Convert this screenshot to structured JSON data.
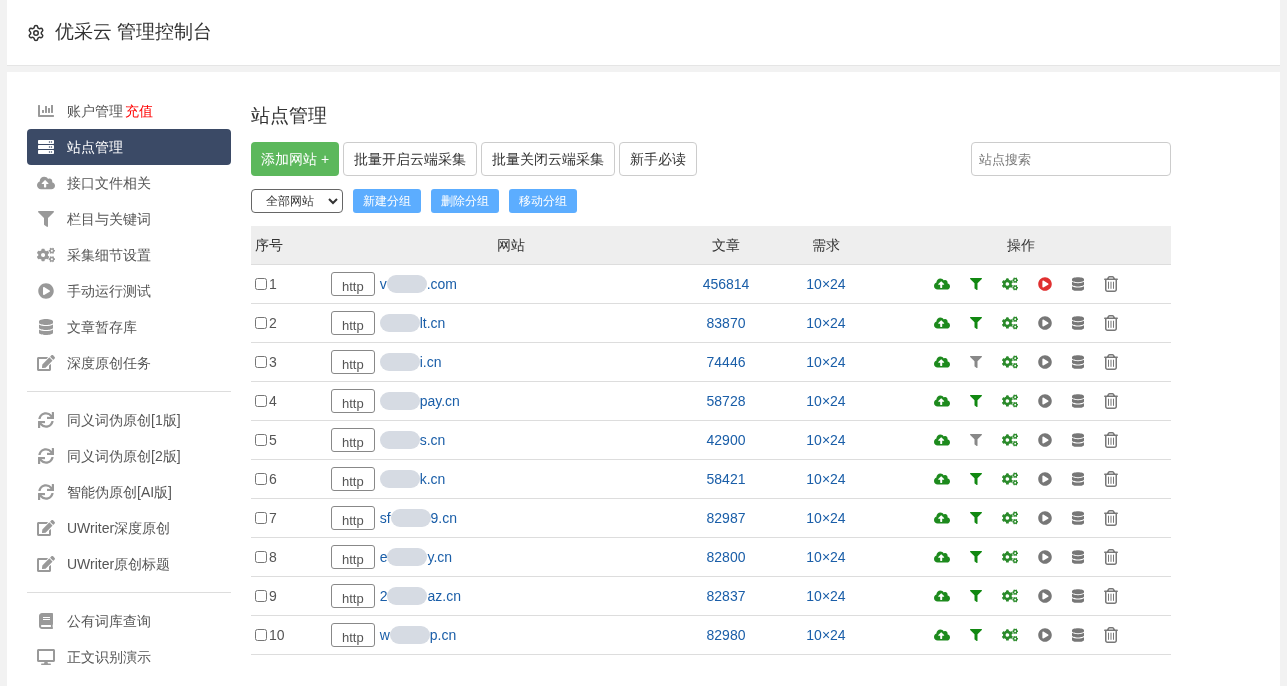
{
  "header": {
    "title": "优采云 管理控制台"
  },
  "sidebar": {
    "groups": [
      [
        {
          "kind": "chart",
          "label": "账户管理",
          "extra": "充值",
          "selected": false
        },
        {
          "kind": "list",
          "label": "站点管理",
          "selected": true
        },
        {
          "kind": "cloud",
          "label": "接口文件相关",
          "selected": false
        },
        {
          "kind": "filter",
          "label": "栏目与关键词",
          "selected": false
        },
        {
          "kind": "cogs",
          "label": "采集细节设置",
          "selected": false
        },
        {
          "kind": "play",
          "label": "手动运行测试",
          "selected": false
        },
        {
          "kind": "database",
          "label": "文章暂存库",
          "selected": false
        },
        {
          "kind": "edit",
          "label": "深度原创任务",
          "selected": false
        }
      ],
      [
        {
          "kind": "sync",
          "label": "同义词伪原创[1版]",
          "selected": false
        },
        {
          "kind": "sync",
          "label": "同义词伪原创[2版]",
          "selected": false
        },
        {
          "kind": "sync",
          "label": "智能伪原创[AI版]",
          "selected": false
        },
        {
          "kind": "edit",
          "label": "UWriter深度原创",
          "selected": false
        },
        {
          "kind": "edit",
          "label": "UWriter原创标题",
          "selected": false
        }
      ],
      [
        {
          "kind": "book",
          "label": "公有词库查询",
          "selected": false
        },
        {
          "kind": "desktop",
          "label": "正文识别演示",
          "selected": false
        }
      ]
    ]
  },
  "main": {
    "title": "站点管理",
    "buttons": [
      {
        "kind": "primary",
        "label": "添加网站 +"
      },
      {
        "kind": "default",
        "label": "批量开启云端采集"
      },
      {
        "kind": "default",
        "label": "批量关闭云端采集"
      },
      {
        "kind": "default",
        "label": "新手必读"
      }
    ],
    "search": {
      "placeholder": "站点搜索"
    },
    "group_select": "全部网站",
    "group_buttons": [
      "新建分组",
      "删除分组",
      "移动分组"
    ],
    "table": {
      "columns": [
        "序号",
        "网站",
        "文章",
        "需求",
        "操作"
      ],
      "rows": [
        {
          "checked": false,
          "no": "1",
          "scheme": "http",
          "prefix": "v",
          "suffix": ".com",
          "articles": "456814",
          "demand": "10×24",
          "filter_on": true,
          "running": true
        },
        {
          "checked": false,
          "no": "2",
          "scheme": "http",
          "prefix": "",
          "suffix": "lt.cn",
          "articles": "83870",
          "demand": "10×24",
          "filter_on": true,
          "running": false
        },
        {
          "checked": false,
          "no": "3",
          "scheme": "http",
          "prefix": "",
          "suffix": "i.cn",
          "articles": "74446",
          "demand": "10×24",
          "filter_on": false,
          "running": false
        },
        {
          "checked": false,
          "no": "4",
          "scheme": "http",
          "prefix": "",
          "suffix": "pay.cn",
          "articles": "58728",
          "demand": "10×24",
          "filter_on": true,
          "running": false
        },
        {
          "checked": false,
          "no": "5",
          "scheme": "http",
          "prefix": "",
          "suffix": "s.cn",
          "articles": "42900",
          "demand": "10×24",
          "filter_on": false,
          "running": false
        },
        {
          "checked": false,
          "no": "6",
          "scheme": "http",
          "prefix": "",
          "suffix": "k.cn",
          "articles": "58421",
          "demand": "10×24",
          "filter_on": true,
          "running": false
        },
        {
          "checked": false,
          "no": "7",
          "scheme": "http",
          "prefix": "sf",
          "suffix": "9.cn",
          "articles": "82987",
          "demand": "10×24",
          "filter_on": true,
          "running": false
        },
        {
          "checked": false,
          "no": "8",
          "scheme": "http",
          "prefix": "e",
          "suffix": "y.cn",
          "articles": "82800",
          "demand": "10×24",
          "filter_on": true,
          "running": false
        },
        {
          "checked": false,
          "no": "9",
          "scheme": "http",
          "prefix": "2",
          "suffix": "az.cn",
          "articles": "82837",
          "demand": "10×24",
          "filter_on": true,
          "running": false
        },
        {
          "checked": false,
          "no": "10",
          "scheme": "http",
          "prefix": "w",
          "suffix": "p.cn",
          "articles": "82980",
          "demand": "10×24",
          "filter_on": true,
          "running": false
        }
      ]
    }
  }
}
